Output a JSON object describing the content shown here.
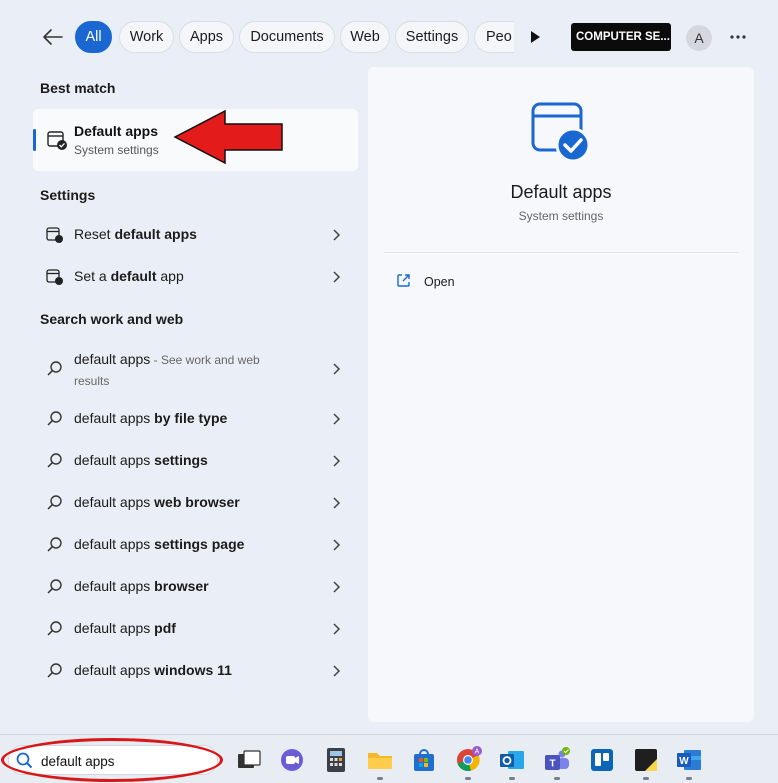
{
  "filters": {
    "chips": [
      {
        "label": "All",
        "active": true
      },
      {
        "label": "Work",
        "active": false
      },
      {
        "label": "Apps",
        "active": false
      },
      {
        "label": "Documents",
        "active": false
      },
      {
        "label": "Web",
        "active": false
      },
      {
        "label": "Settings",
        "active": false
      },
      {
        "label": "Peo",
        "active": false
      }
    ],
    "org_badge": "COMPUTER SE...",
    "avatar_letter": "A",
    "more_label": "···"
  },
  "best_match": {
    "heading": "Best match",
    "title": "Default apps",
    "subtitle": "System settings"
  },
  "settings": {
    "heading": "Settings",
    "items": [
      {
        "prefix": "Reset ",
        "bold": "default apps"
      },
      {
        "prefix": "Set a ",
        "bold": "default",
        "suffix": " app"
      }
    ]
  },
  "web": {
    "heading": "Search work and web",
    "first": {
      "text": "default apps",
      "hint": " - See work and web results"
    },
    "items": [
      {
        "prefix": "default apps ",
        "bold": "by file type"
      },
      {
        "prefix": "default apps ",
        "bold": "settings"
      },
      {
        "prefix": "default apps ",
        "bold": "web browser"
      },
      {
        "prefix": "default apps ",
        "bold": "settings page"
      },
      {
        "prefix": "default apps ",
        "bold": "browser"
      },
      {
        "prefix": "default apps ",
        "bold": "pdf"
      },
      {
        "prefix": "default apps ",
        "bold": "windows 11"
      }
    ]
  },
  "preview": {
    "title": "Default apps",
    "subtitle": "System settings",
    "open_label": "Open"
  },
  "taskbar": {
    "search_value": "default apps",
    "apps": [
      "task-view",
      "chat",
      "calculator",
      "file-explorer",
      "store",
      "chrome",
      "outlook",
      "teams",
      "trello",
      "sticky-notes",
      "word"
    ]
  },
  "colors": {
    "accent": "#1a67d1",
    "annotation": "#d81818"
  }
}
